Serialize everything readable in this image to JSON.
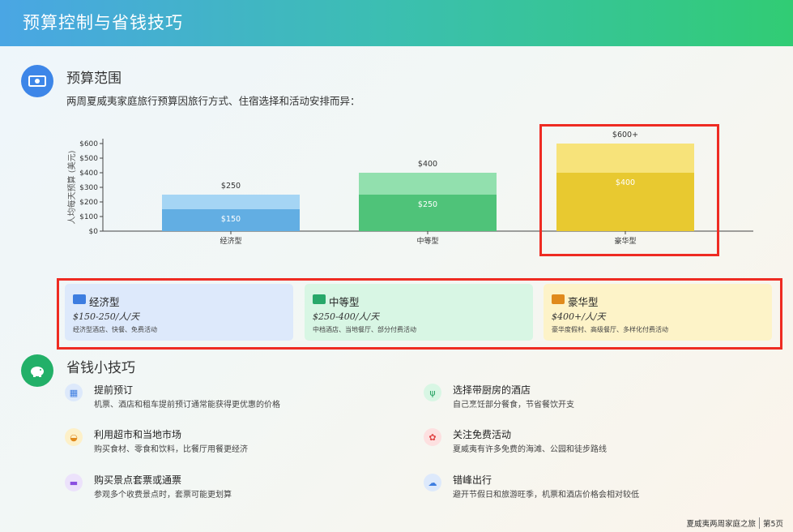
{
  "header": {
    "title": "预算控制与省钱技巧"
  },
  "budget": {
    "title": "预算范围",
    "intro": "两周夏威夷家庭旅行预算因旅行方式、住宿选择和活动安排而异："
  },
  "chart_data": {
    "type": "bar",
    "categories": [
      "经济型",
      "中等型",
      "豪华型"
    ],
    "series": [
      {
        "values": [
          150,
          250,
          400
        ]
      },
      {
        "values": [
          250,
          400,
          600
        ]
      }
    ],
    "bar_labels_inner": [
      "$150",
      "$250",
      "$400"
    ],
    "bar_labels_top": [
      "$250",
      "$400",
      "$600+"
    ],
    "ylabel": "人均每天预算 (美元)",
    "yticks": [
      "$0",
      "$100",
      "$200",
      "$300",
      "$400",
      "$500",
      "$600"
    ],
    "ylim": [
      0,
      650
    ],
    "colors": {
      "low": [
        "#62aee3",
        "#4fc379",
        "#e8c930"
      ],
      "high": [
        "#a5d5f4",
        "#92e0ae",
        "#f7e37a"
      ]
    },
    "grid": false
  },
  "cards": [
    {
      "icon": "bed-icon",
      "title": "经济型",
      "price": "$150-250/人/天",
      "desc": "经济型酒店、快餐、免费活动",
      "bg": "#dde9fb",
      "icon_color": "#3d7de0"
    },
    {
      "icon": "bed-icon",
      "title": "中等型",
      "price": "$250-400/人/天",
      "desc": "中档酒店、当地餐厅、部分付费活动",
      "bg": "#d8f6e4",
      "icon_color": "#28a86a"
    },
    {
      "icon": "bed-icon",
      "title": "豪华型",
      "price": "$400+/人/天",
      "desc": "豪华度假村、高级餐厅、多样化付费活动",
      "bg": "#fdf3c8",
      "icon_color": "#e08a1c"
    }
  ],
  "tips": {
    "title": "省钱小技巧",
    "items": [
      {
        "icon": "calendar-icon",
        "title": "提前预订",
        "desc": "机票、酒店和租车提前预订通常能获得更优惠的价格",
        "bg": "#dde9fb",
        "fg": "#3d7de0",
        "glyph": "▦"
      },
      {
        "icon": "utensils-icon",
        "title": "选择带厨房的酒店",
        "desc": "自己烹饪部分餐食，节省餐饮开支",
        "bg": "#d8f6e4",
        "fg": "#22a060",
        "glyph": "ψ"
      },
      {
        "icon": "basket-icon",
        "title": "利用超市和当地市场",
        "desc": "购买食材、零食和饮料，比餐厅用餐更经济",
        "bg": "#fdf0c8",
        "fg": "#e08a1c",
        "glyph": "◒"
      },
      {
        "icon": "gift-icon",
        "title": "关注免费活动",
        "desc": "夏威夷有许多免费的海滩、公园和徒步路线",
        "bg": "#fde0e0",
        "fg": "#e04444",
        "glyph": "✿"
      },
      {
        "icon": "ticket-icon",
        "title": "购买景点套票或通票",
        "desc": "参观多个收费景点时，套票可能更划算",
        "bg": "#ece2fb",
        "fg": "#8a4fe0",
        "glyph": "▬"
      },
      {
        "icon": "cloud-sun-icon",
        "title": "错峰出行",
        "desc": "避开节假日和旅游旺季，机票和酒店价格会相对较低",
        "bg": "#dde9fb",
        "fg": "#3d7de0",
        "glyph": "☁"
      }
    ]
  },
  "footer": {
    "left": "夏威夷两周家庭之旅",
    "right": "第5页"
  }
}
